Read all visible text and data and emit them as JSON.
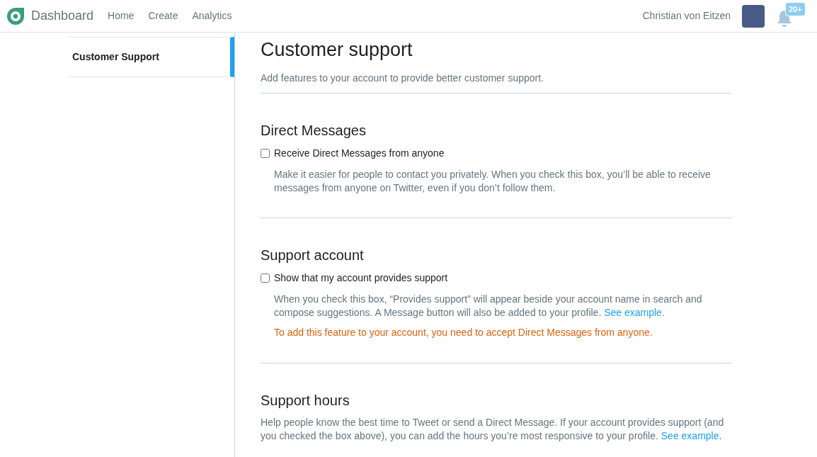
{
  "navbar": {
    "brand": "Dashboard",
    "links": [
      {
        "label": "Home",
        "selected": false
      },
      {
        "label": "Create",
        "selected": false
      },
      {
        "label": "Analytics",
        "selected": false
      }
    ],
    "user_name": "Christian von Eitzen",
    "notification_badge": "20+"
  },
  "sidebar": {
    "items": [
      {
        "label": "Customer Support",
        "selected": true
      }
    ]
  },
  "page": {
    "title": "Customer support",
    "subtitle": "Add features to your account to provide better customer support."
  },
  "sections": [
    {
      "title": "Direct Messages",
      "checkbox": {
        "label": "Receive Direct Messages from anyone",
        "checked": false
      },
      "description": {
        "text": "Make it easier for people to contact you privately. When you check this box, you’ll be able to receive messages from anyone on Twitter, even if you don’t follow them."
      }
    },
    {
      "title": "Support account",
      "checkbox": {
        "label": "Show that my account provides support",
        "checked": false
      },
      "description": {
        "text": "When you check this box, “Provides support” will appear beside your account name in search and compose suggestions. A Message button will also be added to your profile.",
        "link": "See example",
        "after": "."
      },
      "warning": "To add this feature to your account, you need to accept Direct Messages from anyone."
    },
    {
      "title": "Support hours",
      "description": {
        "text": "Help people know the best time to Tweet or send a Direct Message. If your account provides support (and you checked the box above), you can add the hours you’re most responsive to your profile.",
        "link": "See example",
        "after": "."
      }
    }
  ]
}
